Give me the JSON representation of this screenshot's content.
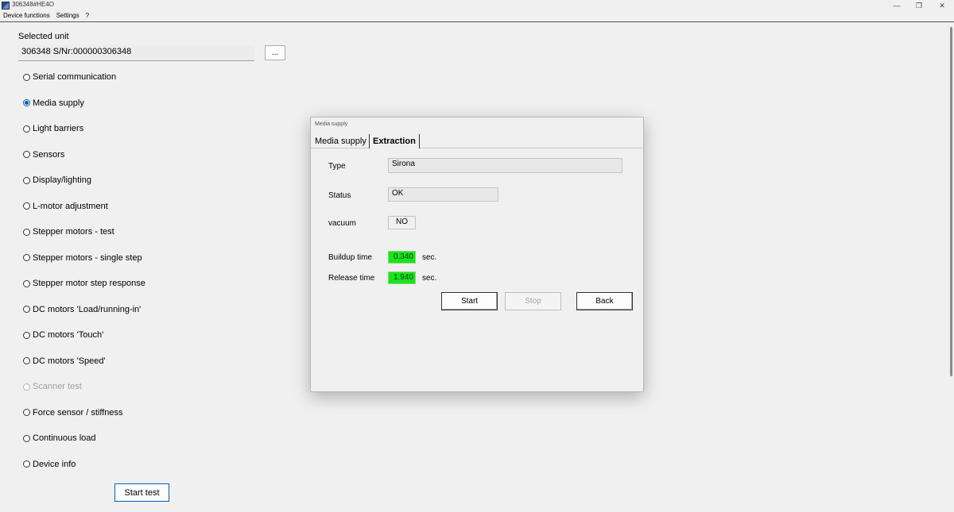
{
  "window": {
    "title": "306348#HE4O",
    "controls": {
      "minimize": "—",
      "maximize": "❐",
      "close": "✕"
    }
  },
  "menu": [
    "Device functions",
    "Settings",
    "?"
  ],
  "left": {
    "selected_unit_label": "Selected unit",
    "selected_unit_value": "306348 S/Nr:000000306348",
    "browse_label": "...",
    "options": [
      {
        "label": "Serial communication",
        "checked": false,
        "disabled": false
      },
      {
        "label": "Media supply",
        "checked": true,
        "disabled": false
      },
      {
        "label": "Light barriers",
        "checked": false,
        "disabled": false
      },
      {
        "label": "Sensors",
        "checked": false,
        "disabled": false
      },
      {
        "label": "Display/lighting",
        "checked": false,
        "disabled": false
      },
      {
        "label": "L-motor adjustment",
        "checked": false,
        "disabled": false
      },
      {
        "label": "Stepper motors - test",
        "checked": false,
        "disabled": false
      },
      {
        "label": "Stepper motors - single step",
        "checked": false,
        "disabled": false
      },
      {
        "label": "Stepper motor step response",
        "checked": false,
        "disabled": false
      },
      {
        "label": "DC motors 'Load/running-in'",
        "checked": false,
        "disabled": false
      },
      {
        "label": "DC motors 'Touch'",
        "checked": false,
        "disabled": false
      },
      {
        "label": "DC motors 'Speed'",
        "checked": false,
        "disabled": false
      },
      {
        "label": "Scanner test",
        "checked": false,
        "disabled": true
      },
      {
        "label": "Force sensor / stiffness",
        "checked": false,
        "disabled": false
      },
      {
        "label": "Continuous load",
        "checked": false,
        "disabled": false
      },
      {
        "label": "Device info",
        "checked": false,
        "disabled": false
      }
    ],
    "start_test_label": "Start test"
  },
  "dialog": {
    "title": "Media supply",
    "tabs": [
      {
        "label": "Media supply",
        "active": false
      },
      {
        "label": "Extraction",
        "active": true
      }
    ],
    "type_label": "Type",
    "type_value": "Sirona",
    "status_label": "Status",
    "status_value": "OK",
    "vacuum_label": "vacuum",
    "vacuum_value": "NO",
    "buildup_label": "Buildup time",
    "buildup_value": "0.340",
    "release_label": "Release time",
    "release_value": "1.940",
    "unit_sec": "sec.",
    "buttons": {
      "start": "Start",
      "stop": "Stop",
      "back": "Back"
    },
    "result_color": "#19e419"
  }
}
